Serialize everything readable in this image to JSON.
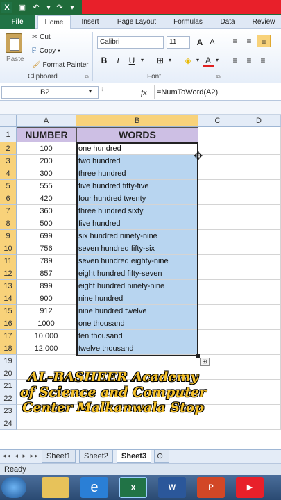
{
  "ribbon": {
    "tabs": [
      "File",
      "Home",
      "Insert",
      "Page Layout",
      "Formulas",
      "Data",
      "Review"
    ],
    "clipboard": {
      "cut": "Cut",
      "copy": "Copy",
      "format_painter": "Format Painter",
      "paste": "Paste",
      "label": "Clipboard"
    },
    "font": {
      "name": "Calibri",
      "size": "11",
      "bold": "B",
      "italic": "I",
      "underline": "U",
      "label": "Font"
    }
  },
  "formula_bar": {
    "name_box": "B2",
    "fx": "fx",
    "formula": "=NumToWord(A2)"
  },
  "grid": {
    "columns": [
      "A",
      "B",
      "C",
      "D"
    ],
    "headers": {
      "a": "NUMBER",
      "b": "WORDS"
    },
    "rows": [
      {
        "n": "100",
        "w": "one hundred"
      },
      {
        "n": "200",
        "w": "two hundred"
      },
      {
        "n": "300",
        "w": "three hundred"
      },
      {
        "n": "555",
        "w": "five hundred fifty-five"
      },
      {
        "n": "420",
        "w": "four hundred twenty"
      },
      {
        "n": "360",
        "w": "three hundred sixty"
      },
      {
        "n": "500",
        "w": "five hundred"
      },
      {
        "n": "699",
        "w": "six hundred ninety-nine"
      },
      {
        "n": "756",
        "w": "seven hundred fifty-six"
      },
      {
        "n": "789",
        "w": "seven hundred eighty-nine"
      },
      {
        "n": "857",
        "w": "eight hundred fifty-seven"
      },
      {
        "n": "899",
        "w": "eight hundred ninety-nine"
      },
      {
        "n": "900",
        "w": "nine hundred"
      },
      {
        "n": "912",
        "w": "nine hundred twelve"
      },
      {
        "n": "1000",
        "w": "one thousand"
      },
      {
        "n": "10,000",
        "w": "ten thousand"
      },
      {
        "n": "12,000",
        "w": "twelve thousand"
      }
    ],
    "extra_rows": [
      "19",
      "20",
      "21",
      "22",
      "23",
      "24"
    ]
  },
  "overlay_text": [
    "AL-BASHEER Academy",
    "of Science and Computer",
    "Center Malkanwala Stop"
  ],
  "sheets": [
    "Sheet1",
    "Sheet2",
    "Sheet3"
  ],
  "active_sheet": "Sheet3",
  "status": "Ready",
  "colors": {
    "excel_green": "#217346",
    "header_fill": "#cdbfe4",
    "selection_fill": "#b8d5f0",
    "overlay_text": "#f6c22a"
  }
}
